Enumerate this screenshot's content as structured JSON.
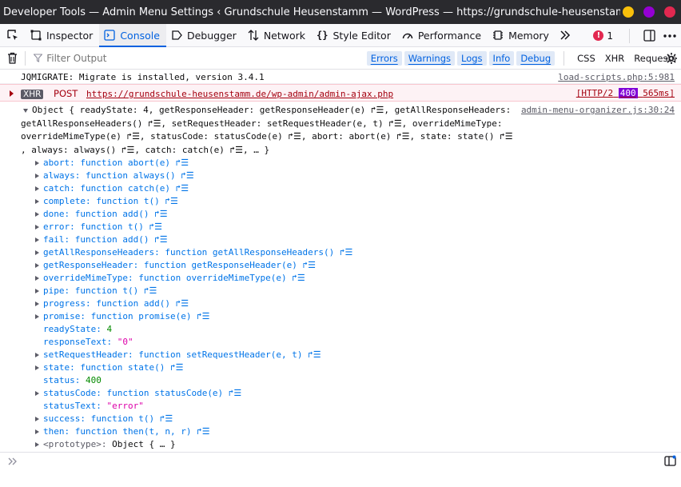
{
  "window": {
    "title": "Developer Tools — Admin Menu Settings ‹ Grundschule Heusenstamm — WordPress — https://grundschule-heusenstamm.de...",
    "buttons": {
      "minimize_color": "#f9c00b",
      "maximize_color": "#9400d3",
      "close_color": "#e22850"
    }
  },
  "toolbar": {
    "tabs": [
      {
        "label": "Inspector",
        "icon": "inspector-icon"
      },
      {
        "label": "Console",
        "icon": "console-icon"
      },
      {
        "label": "Debugger",
        "icon": "debugger-icon"
      },
      {
        "label": "Network",
        "icon": "network-icon"
      },
      {
        "label": "Style Editor",
        "icon": "style-editor-icon"
      },
      {
        "label": "Performance",
        "icon": "performance-icon"
      },
      {
        "label": "Memory",
        "icon": "memory-icon"
      }
    ],
    "error_count": "1",
    "accent": "#0061e0"
  },
  "filter": {
    "placeholder": "Filter Output",
    "levels": [
      "Errors",
      "Warnings",
      "Logs",
      "Info",
      "Debug"
    ],
    "types": [
      "CSS",
      "XHR",
      "Requests"
    ]
  },
  "messages": {
    "jqmigrate": {
      "text": "JQMIGRATE: Migrate is installed, version 3.4.1",
      "location": "load-scripts.php:5:981"
    },
    "xhr": {
      "tag": "XHR",
      "method": "POST",
      "url": "https://grundschule-heusenstamm.de/wp-admin/admin-ajax.php",
      "proto": "[HTTP/2",
      "status": "400",
      "time": "565ms]"
    },
    "object": {
      "location": "admin-menu-organizer.js:30:24",
      "header_lines": [
        "Object { readyState: 4, getResponseHeader: getResponseHeader(e) ↱☰, getAllResponseHeaders:",
        "getAllResponseHeaders() ↱☰, setRequestHeader: setRequestHeader(e, t) ↱☰, overrideMimeType:",
        "overrideMimeType(e) ↱☰, statusCode: statusCode(e) ↱☰, abort: abort(e) ↱☰, state: state() ↱☰",
        ", always: always() ↱☰, catch: catch(e) ↱☰, … }"
      ],
      "props": [
        {
          "key": "abort:",
          "val": "function abort(e) ↱☰",
          "expandable": true
        },
        {
          "key": "always:",
          "val": "function always() ↱☰",
          "expandable": true
        },
        {
          "key": "catch:",
          "val": "function catch(e) ↱☰",
          "expandable": true
        },
        {
          "key": "complete:",
          "val": "function t() ↱☰",
          "expandable": true
        },
        {
          "key": "done:",
          "val": "function add() ↱☰",
          "expandable": true
        },
        {
          "key": "error:",
          "val": "function t() ↱☰",
          "expandable": true
        },
        {
          "key": "fail:",
          "val": "function add() ↱☰",
          "expandable": true
        },
        {
          "key": "getAllResponseHeaders:",
          "val": "function getAllResponseHeaders() ↱☰",
          "expandable": true
        },
        {
          "key": "getResponseHeader:",
          "val": "function getResponseHeader(e) ↱☰",
          "expandable": true
        },
        {
          "key": "overrideMimeType:",
          "val": "function overrideMimeType(e) ↱☰",
          "expandable": true
        },
        {
          "key": "pipe:",
          "val": "function t() ↱☰",
          "expandable": true
        },
        {
          "key": "progress:",
          "val": "function add() ↱☰",
          "expandable": true
        },
        {
          "key": "promise:",
          "val": "function promise(e) ↱☰",
          "expandable": true
        },
        {
          "key": "readyState:",
          "val": "4",
          "expandable": false,
          "kind": "num"
        },
        {
          "key": "responseText:",
          "val": "\"0\"",
          "expandable": false,
          "kind": "str"
        },
        {
          "key": "setRequestHeader:",
          "val": "function setRequestHeader(e, t) ↱☰",
          "expandable": true
        },
        {
          "key": "state:",
          "val": "function state() ↱☰",
          "expandable": true
        },
        {
          "key": "status:",
          "val": "400",
          "expandable": false,
          "kind": "num"
        },
        {
          "key": "statusCode:",
          "val": "function statusCode(e) ↱☰",
          "expandable": true
        },
        {
          "key": "statusText:",
          "val": "\"error\"",
          "expandable": false,
          "kind": "str"
        },
        {
          "key": "success:",
          "val": "function t() ↱☰",
          "expandable": true
        },
        {
          "key": "then:",
          "val": "function then(t, n, r) ↱☰",
          "expandable": true
        },
        {
          "key": "<prototype>:",
          "val": "Object { … }",
          "expandable": true,
          "kind": "proto"
        }
      ]
    }
  }
}
